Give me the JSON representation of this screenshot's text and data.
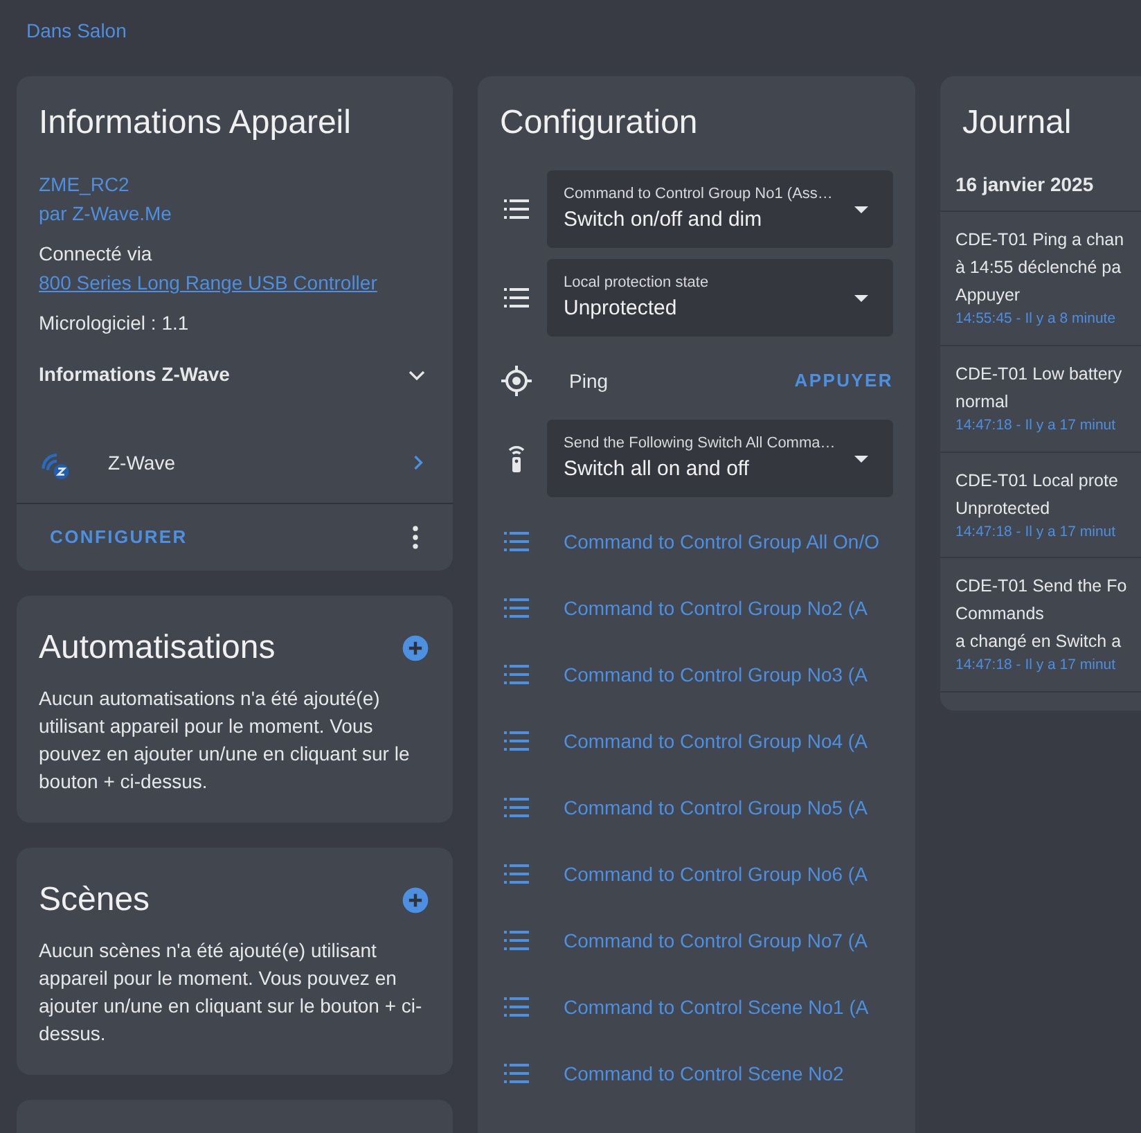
{
  "breadcrumb": "Dans Salon",
  "device_info": {
    "title": "Informations Appareil",
    "model": "ZME_RC2",
    "manufacturer": "par Z-Wave.Me",
    "connected_prefix": "Connecté via",
    "connected_link": "800 Series Long Range USB Controller",
    "firmware": "Micrologiciel : 1.1",
    "expander": {
      "label": "Informations Z-Wave",
      "expanded": false
    },
    "integration": "Z-Wave",
    "action": "CONFIGURER"
  },
  "sections": [
    {
      "title": "Automatisations",
      "text": "Aucun automatisations n'a été ajouté(e) utilisant appareil pour le moment. Vous pouvez en ajouter un/une en cliquant sur le bouton + ci-dessus."
    },
    {
      "title": "Scènes",
      "text": "Aucun scènes n'a été ajouté(e) utilisant appareil pour le moment. Vous pouvez en ajouter un/une en cliquant sur le bouton + ci-dessus."
    }
  ],
  "configuration": {
    "title": "Configuration",
    "items": [
      {
        "kind": "select",
        "label": "Command to Control Group No1 (Ass…",
        "value": "Switch on/off and dim"
      },
      {
        "kind": "select",
        "label": "Local protection state",
        "value": "Unprotected"
      },
      {
        "kind": "button",
        "label": "Ping",
        "action": "APPUYER"
      },
      {
        "kind": "remote",
        "label": "Send the Following Switch All Comma…",
        "value": "Switch all on and off"
      },
      {
        "kind": "link",
        "label": "Command to Control Group All On/O"
      },
      {
        "kind": "link",
        "label": "Command to Control Group No2 (A"
      },
      {
        "kind": "link",
        "label": "Command to Control Group No3 (A"
      },
      {
        "kind": "link",
        "label": "Command to Control Group No4 (A"
      },
      {
        "kind": "link",
        "label": "Command to Control Group No5 (A"
      },
      {
        "kind": "link",
        "label": "Command to Control Group No6 (A"
      },
      {
        "kind": "link",
        "label": "Command to Control Group No7 (A"
      },
      {
        "kind": "link",
        "label": "Command to Control Scene No1 (A"
      },
      {
        "kind": "link",
        "label": "Command to Control Scene No2"
      }
    ]
  },
  "journal": {
    "title": "Journal",
    "date": "16 janvier 2025",
    "entries": [
      {
        "lines": [
          "CDE-T01 Ping a chan",
          "à 14:55 déclenché pa",
          "Appuyer"
        ],
        "time": "14:55:45 - Il y a 8 minute"
      },
      {
        "lines": [
          "CDE-T01 Low battery",
          "normal"
        ],
        "time": "14:47:18 - Il y a 17 minut"
      },
      {
        "lines": [
          "CDE-T01 Local prote",
          "Unprotected"
        ],
        "time": "14:47:18 - Il y a 17 minut"
      },
      {
        "lines": [
          "CDE-T01 Send the Fo",
          "Commands",
          "a changé en Switch a"
        ],
        "time": "14:47:18 - Il y a 17 minut"
      }
    ]
  }
}
